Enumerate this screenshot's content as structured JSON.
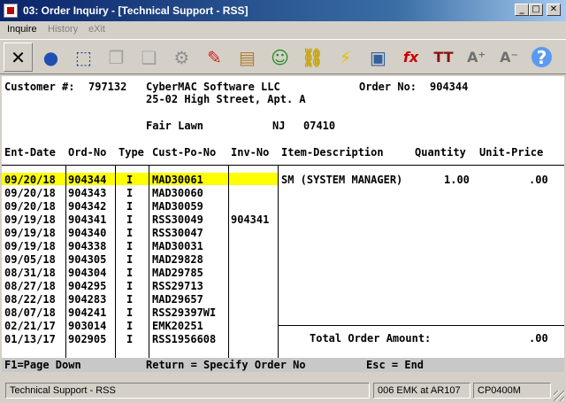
{
  "window": {
    "title": "03: Order Inquiry - [Technical Support - RSS]",
    "min_glyph": "_",
    "max_glyph": "□",
    "close_glyph": "✕"
  },
  "menu": [
    {
      "label": "Inquire",
      "enabled": true
    },
    {
      "label": "History",
      "enabled": false
    },
    {
      "label": "eXit",
      "enabled": false
    }
  ],
  "toolbar": [
    {
      "icon": "cross-icon",
      "glyph": "✕",
      "color": "#000000"
    },
    {
      "icon": "globe-icon",
      "glyph": "●",
      "color": "#1f4fb0"
    },
    {
      "icon": "select-box-icon",
      "glyph": "⬚",
      "color": "#1f3fa0"
    },
    {
      "icon": "copy-icon",
      "glyph": "❐",
      "color": "#a0a0a0"
    },
    {
      "icon": "paste-icon",
      "glyph": "❏",
      "color": "#a0a0a0"
    },
    {
      "icon": "gear-icon",
      "glyph": "⚙",
      "color": "#909090"
    },
    {
      "icon": "edit-pencil-icon",
      "glyph": "✎",
      "color": "#d02020"
    },
    {
      "icon": "notepad-icon",
      "glyph": "▤",
      "color": "#b08030"
    },
    {
      "icon": "users-icon",
      "glyph": "☺",
      "color": "#2a8a2a"
    },
    {
      "icon": "link-chain-icon",
      "glyph": "⛓",
      "color": "#c9a200"
    },
    {
      "icon": "lightning-icon",
      "glyph": "⚡",
      "color": "#e0c000"
    },
    {
      "icon": "window-lightning-icon",
      "glyph": "▣",
      "color": "#3060a0"
    },
    {
      "icon": "function-fx-icon",
      "glyph": "fx",
      "color": "#d00000"
    },
    {
      "icon": "font-size-icon",
      "glyph": "TT",
      "color": "#8a1010"
    },
    {
      "icon": "increase-font-icon",
      "glyph": "A⁺",
      "color": "#707070"
    },
    {
      "icon": "decrease-font-icon",
      "glyph": "A⁻",
      "color": "#707070"
    },
    {
      "icon": "help-icon",
      "glyph": "?",
      "color": "#2060d0"
    }
  ],
  "customer": {
    "label": "Customer #:",
    "number": "797132",
    "name": "CyberMAC Software LLC",
    "address1": "25-02 High Street, Apt. A",
    "city": "Fair Lawn",
    "state": "NJ",
    "zip": "07410"
  },
  "order": {
    "label": "Order No:",
    "number": "904344"
  },
  "columns": [
    "Ent-Date",
    "Ord-No",
    "Type",
    "Cust-Po-No",
    "Inv-No",
    "Item-Description",
    "Quantity",
    "Unit-Price"
  ],
  "orders": [
    {
      "date": "09/20/18",
      "ord": "904344",
      "type": "I",
      "po": "MAD30061",
      "inv": ""
    },
    {
      "date": "09/20/18",
      "ord": "904343",
      "type": "I",
      "po": "MAD30060",
      "inv": ""
    },
    {
      "date": "09/20/18",
      "ord": "904342",
      "type": "I",
      "po": "MAD30059",
      "inv": ""
    },
    {
      "date": "09/19/18",
      "ord": "904341",
      "type": "I",
      "po": "RSS30049",
      "inv": "904341"
    },
    {
      "date": "09/19/18",
      "ord": "904340",
      "type": "I",
      "po": "RSS30047",
      "inv": ""
    },
    {
      "date": "09/19/18",
      "ord": "904338",
      "type": "I",
      "po": "MAD30031",
      "inv": ""
    },
    {
      "date": "09/05/18",
      "ord": "904305",
      "type": "I",
      "po": "MAD29828",
      "inv": ""
    },
    {
      "date": "08/31/18",
      "ord": "904304",
      "type": "I",
      "po": "MAD29785",
      "inv": ""
    },
    {
      "date": "08/27/18",
      "ord": "904295",
      "type": "I",
      "po": "RSS29713",
      "inv": ""
    },
    {
      "date": "08/22/18",
      "ord": "904283",
      "type": "I",
      "po": "MAD29657",
      "inv": ""
    },
    {
      "date": "08/07/18",
      "ord": "904241",
      "type": "I",
      "po": "RSS29397WI",
      "inv": ""
    },
    {
      "date": "02/21/17",
      "ord": "903014",
      "type": "I",
      "po": "EMK20251",
      "inv": ""
    },
    {
      "date": "01/13/17",
      "ord": "902905",
      "type": "I",
      "po": "RSS1956608",
      "inv": ""
    }
  ],
  "selected_row": 0,
  "line_items": [
    {
      "desc": "SM (SYSTEM MANAGER)",
      "qty": "1.00",
      "price": ".00"
    }
  ],
  "total": {
    "label": "Total Order Amount:",
    "value": ".00"
  },
  "function_keys": {
    "f1": "F1=Page Down",
    "ret": "Return = Specify Order No",
    "esc": "Esc = End"
  },
  "status": {
    "session": "Technical Support - RSS",
    "user": "006 EMK at AR107",
    "program": "CP0400M"
  },
  "colors": {
    "highlight": "#ffff00",
    "title_start": "#0a246a",
    "title_end": "#a6caf0"
  }
}
